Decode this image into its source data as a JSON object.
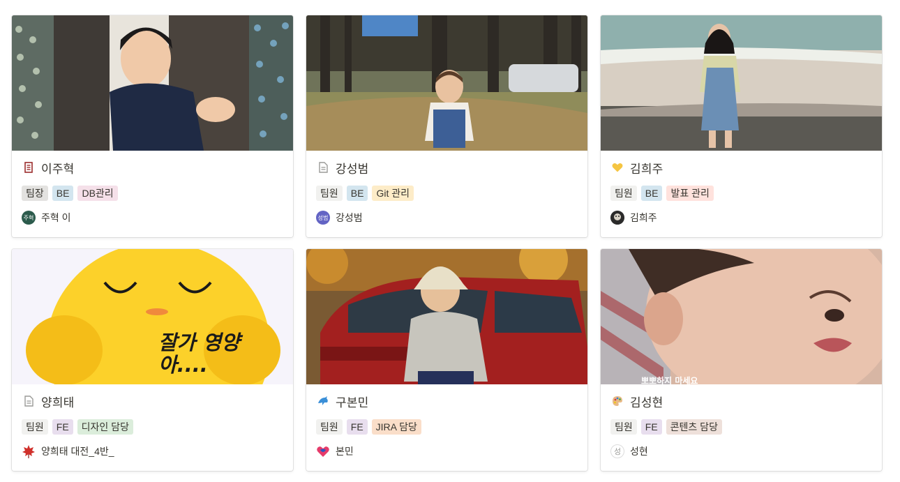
{
  "cards": [
    {
      "title": "이주혁",
      "icon": "bookmark-icon",
      "tags": [
        {
          "label": "팀장",
          "color": "#e3e2e0"
        },
        {
          "label": "BE",
          "color": "#d3e5ef"
        },
        {
          "label": "DB관리",
          "color": "#f5e0e9"
        }
      ],
      "person": {
        "avatar_text": "주혁",
        "avatar_color": "#2c5b4c",
        "name": "주혁 이"
      }
    },
    {
      "title": "강성범",
      "icon": "document-icon",
      "tags": [
        {
          "label": "팀원",
          "color": "#f1f1ef"
        },
        {
          "label": "BE",
          "color": "#d3e5ef"
        },
        {
          "label": "Git 관리",
          "color": "#fdecc8"
        }
      ],
      "person": {
        "avatar_text": "성범",
        "avatar_color": "#6364c4",
        "name": "강성범"
      }
    },
    {
      "title": "김희주",
      "icon": "yellow-heart-icon",
      "tags": [
        {
          "label": "팀원",
          "color": "#f1f1ef"
        },
        {
          "label": "BE",
          "color": "#d3e5ef"
        },
        {
          "label": "발표 관리",
          "color": "#ffe2dd"
        }
      ],
      "person": {
        "avatar_text": "",
        "avatar_color": "#3a3a3a",
        "name": "김희주"
      }
    },
    {
      "title": "양희태",
      "icon": "document-icon",
      "cover_text": "잘가 영양\n아....",
      "tags": [
        {
          "label": "팀원",
          "color": "#f1f1ef"
        },
        {
          "label": "FE",
          "color": "#e8deee"
        },
        {
          "label": "디자인 담당",
          "color": "#dbeddb"
        }
      ],
      "person": {
        "avatar_text": "",
        "avatar_color": "#c0392b",
        "name": "양희태 대전_4반_"
      }
    },
    {
      "title": "구본민",
      "icon": "dolphin-icon",
      "tags": [
        {
          "label": "팀원",
          "color": "#f1f1ef"
        },
        {
          "label": "FE",
          "color": "#e8deee"
        },
        {
          "label": "JIRA 담당",
          "color": "#fadec9"
        }
      ],
      "person": {
        "avatar_text": "",
        "avatar_color": "#e53b6a",
        "name": "본민"
      }
    },
    {
      "title": "김성현",
      "icon": "palette-icon",
      "cover_text": "뽀뽀하지 마세요",
      "tags": [
        {
          "label": "팀원",
          "color": "#f1f1ef"
        },
        {
          "label": "FE",
          "color": "#e8deee"
        },
        {
          "label": "콘텐츠 담당",
          "color": "#eee0da"
        }
      ],
      "person": {
        "avatar_text": "성",
        "avatar_color": "#ffffff",
        "name": "성현"
      }
    }
  ]
}
